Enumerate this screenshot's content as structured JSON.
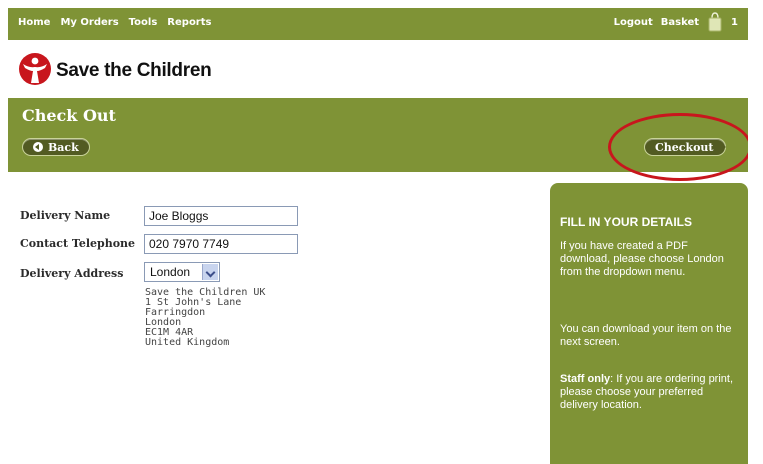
{
  "nav": {
    "left": [
      "Home",
      "My Orders",
      "Tools",
      "Reports"
    ],
    "logout": "Logout",
    "basket": "Basket",
    "basket_count": "1"
  },
  "brand": {
    "name": "Save the Children",
    "color": "#c8161d"
  },
  "header": {
    "title": "Check Out",
    "back_label": "Back",
    "checkout_label": "Checkout"
  },
  "form": {
    "delivery_name_label": "Delivery Name",
    "delivery_name_value": "Joe Bloggs",
    "telephone_label": "Contact Telephone",
    "telephone_value": "020 7970 7749",
    "address_label": "Delivery Address",
    "address_selected": "London",
    "address_lines": [
      "Save the Children UK",
      "1 St John's Lane",
      "Farringdon",
      "London",
      "EC1M 4AR",
      "United Kingdom"
    ]
  },
  "sidebar": {
    "title": "FILL IN YOUR DETAILS",
    "p1": "If you have created a PDF download, please choose London from the dropdown menu.",
    "p2": "You can download your item on the next screen.",
    "p3_bold": "Staff only",
    "p3_rest": ": If you are ordering print, please choose your preferred delivery location."
  },
  "colors": {
    "header_green": "#7f9336",
    "button_dark": "#525b22",
    "annotation_red": "#c8161d"
  },
  "icons": {
    "basket": "basket-bag-icon",
    "logo": "child-figure-logo-icon",
    "back": "arrow-left-circle-icon",
    "checkout": "arrow-right-circle-icon"
  }
}
